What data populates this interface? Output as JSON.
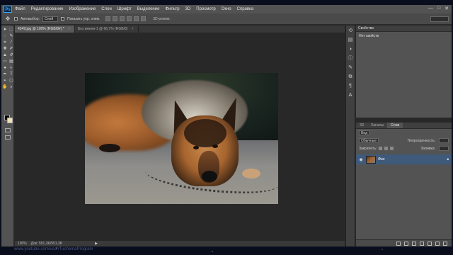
{
  "menubar": {
    "logo": "Ps",
    "items": [
      "Файл",
      "Редактирование",
      "Изображение",
      "Слои",
      "Шрифт",
      "Выделение",
      "Фильтр",
      "3D",
      "Просмотр",
      "Окно",
      "Справка"
    ],
    "win_min": "—",
    "win_max": "□",
    "win_close": "✕"
  },
  "options": {
    "autoselect_label": "Автовыбор:",
    "autoselect_value": "Слой",
    "transform_label": "Показать упр. элем.",
    "mode3d_label": "3D-режим:"
  },
  "tabs": [
    {
      "label": "4249.jpg @ 100% (RGB/8#) *",
      "close": "×"
    },
    {
      "label": "Без имени-1 @ 66,7% (RGB/8)",
      "close": "×"
    }
  ],
  "status": {
    "zoom": "100%",
    "doc": "Док: 551,3K/551,3K",
    "arrow": "▶"
  },
  "properties": {
    "title": "Свойства",
    "body": "Нет свойств"
  },
  "layers": {
    "tabs": [
      "3D",
      "Каналы",
      "Слои"
    ],
    "filter_label": "Вид",
    "blend_mode": "Обычные",
    "opacity_label": "Непрозрачность:",
    "lock_label": "Закрепить:",
    "fill_label": "Заливка:",
    "layer_name": "Фон"
  },
  "watermark": "www.youtube.com/user/TuchemaProgram"
}
